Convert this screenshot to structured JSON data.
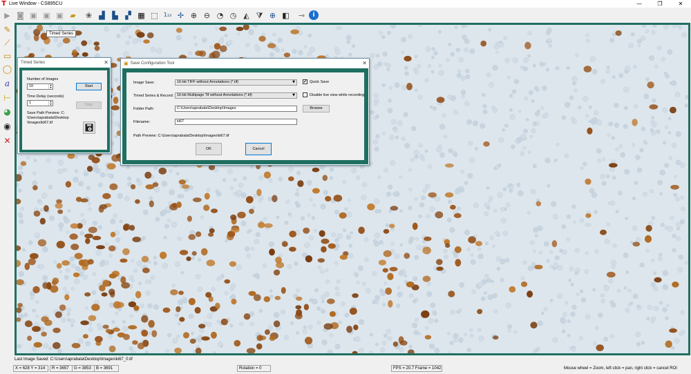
{
  "window": {
    "title": "Live Window - CS895CU",
    "minimize": "—",
    "maximize": "❐",
    "close": "✕",
    "accent_color": "#1f6f61"
  },
  "toolbar": {
    "tooltip": "Timed Series",
    "items": [
      "play-icon",
      "camera-icon",
      "save-icon",
      "save-as-icon",
      "save-settings-icon",
      "open-folder-icon",
      "gallery-icon",
      "histogram-icon",
      "rgb-histogram-icon",
      "channel-histogram-icon",
      "grid-icon",
      "selection-icon",
      "numbering-icon",
      "fit-icon",
      "zoom-1-1-icon",
      "zoom-1-2-icon",
      "timer-icon",
      "clock-icon",
      "flip-icon",
      "mirror-icon",
      "crosshair-icon",
      "levels-icon",
      "plug-icon",
      "info-icon"
    ]
  },
  "left_tools": [
    "pencil-icon",
    "line-icon",
    "rectangle-icon",
    "circle-icon",
    "text-icon",
    "measure-icon",
    "color-wheel-icon",
    "stopwatch-icon",
    "delete-icon"
  ],
  "timed_series": {
    "title": "Timed Series",
    "number_label": "Number of Images",
    "number_value": "10",
    "delay_label": "Time Delay (seconds)",
    "delay_value": "1",
    "start_label": "Start",
    "stop_label": "Stop",
    "path_preview_line1": "Save Path Preview: C:",
    "path_preview_line2": "\\Users\\aprabala\\Desktop",
    "path_preview_line3": "\\Images\\ki67.tif"
  },
  "save_config": {
    "title": "Save Configuration Tool",
    "image_save_label": "Image Save:",
    "image_save_value": "16-bit TIFF without Annotations (*.tif)",
    "timed_label": "Timed Series & Record:",
    "timed_value": "16-bit Multipage Tif without Annotations (*.tif)",
    "quick_save_label": "Quick Save",
    "quick_save_checked": "✔",
    "disable_live_label": "Disable live view while recording",
    "folder_label": "Folder Path:",
    "folder_value": "C:\\Users\\aprabala\\Desktop\\Images",
    "browse_label": "Browse",
    "filename_label": "Filename:",
    "filename_value": "ki67",
    "path_preview": "Path Preview: C:\\Users\\aprabala\\Desktop\\Images\\ki67.tif",
    "ok_label": "OK",
    "cancel_label": "Cancel"
  },
  "status": {
    "last_saved": "Last Image Saved: C:\\Users\\aprabala\\Desktop\\Images\\ki67_0.tif",
    "coords": "X = 628  Y = 314",
    "r": "R = 3657",
    "g": "G = 3853",
    "b": "B = 3691",
    "rotation": "Rotation = 0",
    "fps": "FPS = 20.7  Frame = 1042",
    "help": "Mouse wheel = Zoom, left click = pan, right click = cancel ROI"
  }
}
